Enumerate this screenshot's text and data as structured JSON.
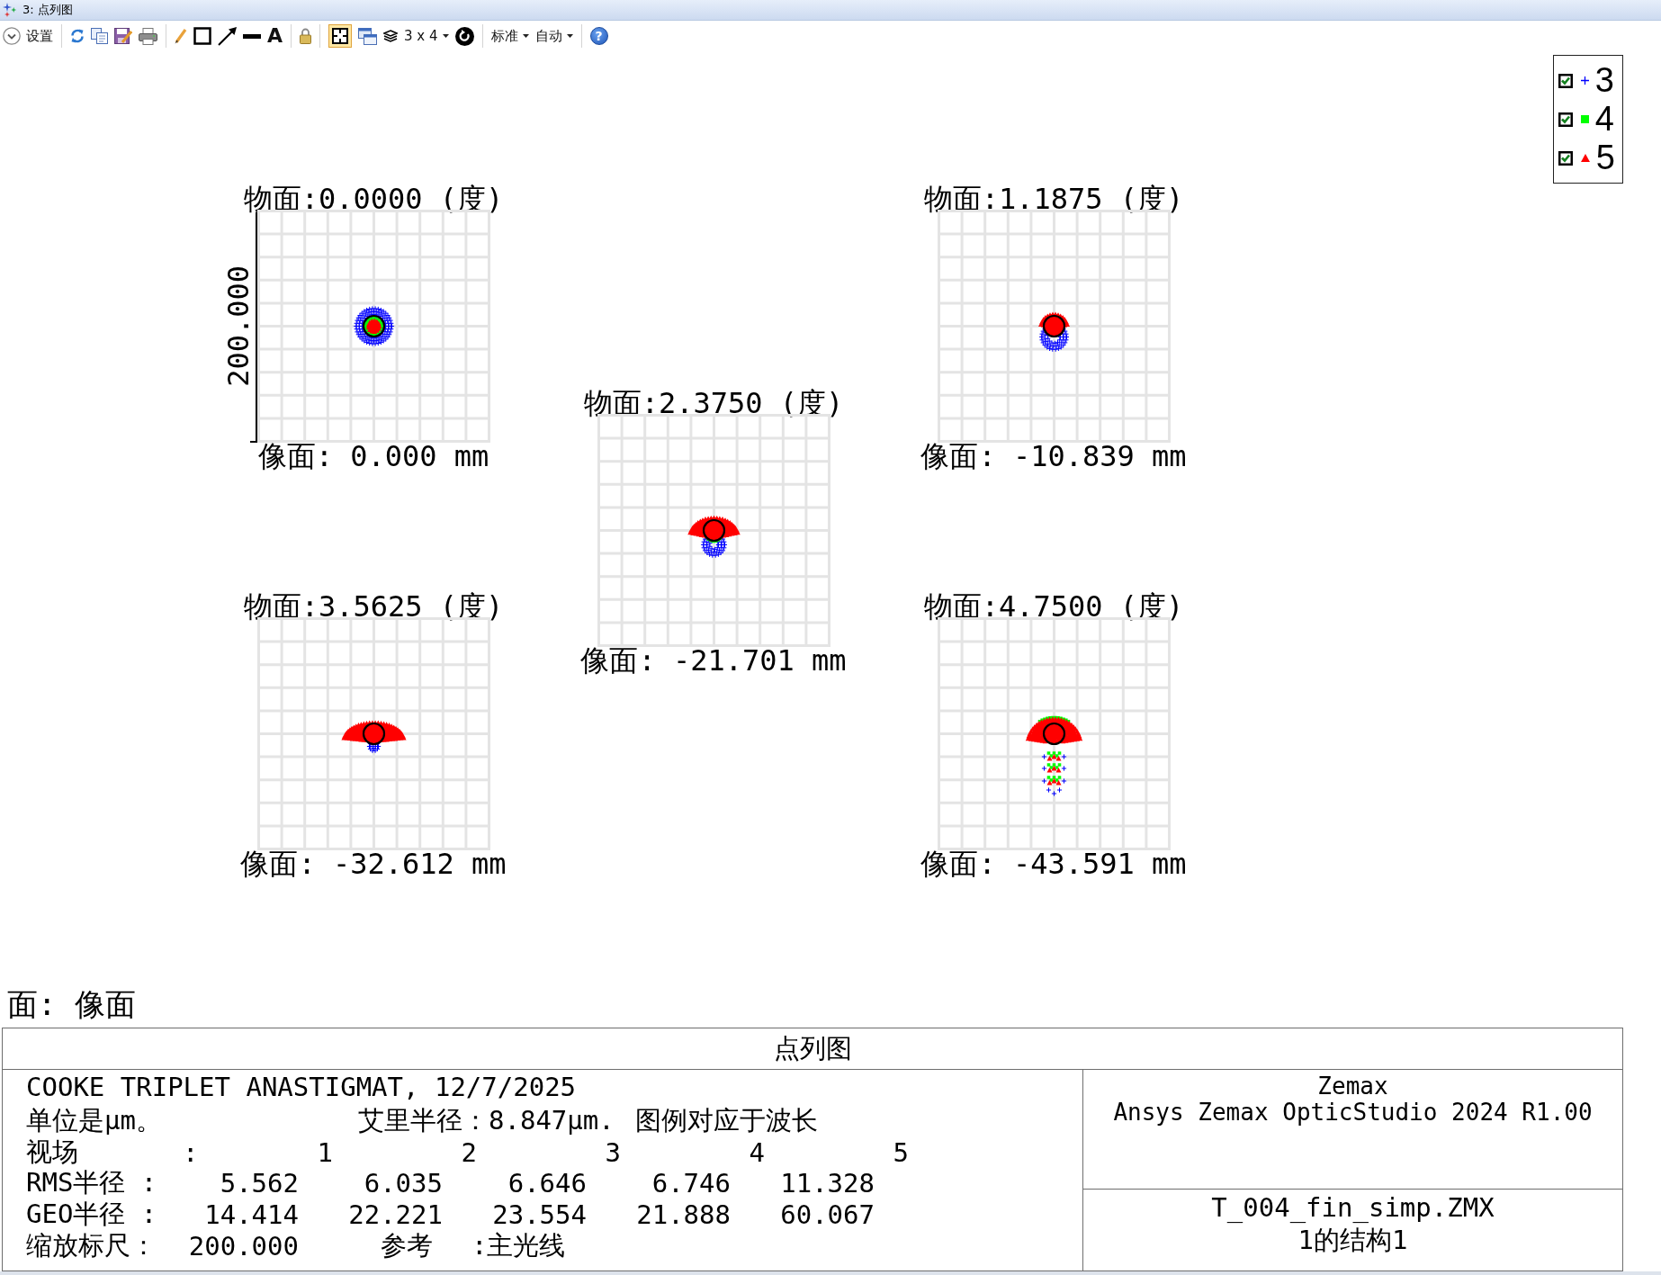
{
  "window": {
    "title": "3: 点列图"
  },
  "toolbar": {
    "settings": "设置",
    "text_tool": "A",
    "grid_toggle": {
      "selected": true
    },
    "layout": "3 x 4",
    "dropdowns": [
      "标准",
      "自动"
    ],
    "help": "?"
  },
  "legend": [
    {
      "label": "3",
      "checked": true,
      "kind": "plus",
      "color": "#0000ff"
    },
    {
      "label": "4",
      "checked": true,
      "kind": "square",
      "color": "#00ff00"
    },
    {
      "label": "5",
      "checked": true,
      "kind": "triangle",
      "color": "#ff0000"
    }
  ],
  "plots": [
    {
      "title": "物面:0.0000 (度)",
      "image_height": "像面: 0.000 mm",
      "scale_label": "200.000"
    },
    {
      "title": "物面:1.1875 (度)",
      "image_height": "像面: -10.839 mm"
    },
    {
      "title": "物面:2.3750 (度)",
      "image_height": "像面: -21.701 mm"
    },
    {
      "title": "物面:3.5625 (度)",
      "image_height": "像面: -32.612 mm"
    },
    {
      "title": "物面:4.7500 (度)",
      "image_height": "像面: -43.591 mm"
    }
  ],
  "surface_label": "面: 像面",
  "report": {
    "header": "点列图",
    "lens_title": "COOKE TRIPLET ANASTIGMAT, 12/7/2025",
    "units": "单位是μm。",
    "airy_radius": "艾里半径：8.847μm.",
    "legend_note": "图例对应于波长",
    "field_row": {
      "label": "视场",
      "separator": ":",
      "values": [
        "1",
        "2",
        "3",
        "4",
        "5"
      ]
    },
    "rms_row": {
      "label": "RMS半径 :",
      "values": [
        "5.562",
        "6.035",
        "6.646",
        "6.746",
        "11.328"
      ]
    },
    "geo_row": {
      "label": "GEO半径 :",
      "values": [
        "14.414",
        "22.221",
        "23.554",
        "21.888",
        "60.067"
      ]
    },
    "scale_row": {
      "label": "缩放标尺：",
      "value": "200.000",
      "reference_label": "参考",
      "reference_value": ":主光线"
    },
    "program": [
      "Zemax",
      "Ansys Zemax OpticStudio 2024 R1.00"
    ],
    "file": [
      "T_004_fin_simp.ZMX",
      "1的结构1"
    ]
  }
}
